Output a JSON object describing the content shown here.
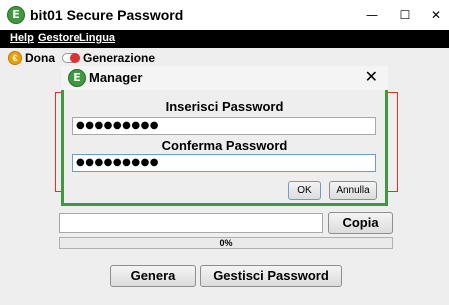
{
  "window": {
    "title": "bit01 Secure Password",
    "minimize_glyph": "—",
    "maximize_glyph": "☐",
    "close_glyph": "✕"
  },
  "menu": {
    "items": [
      "Help",
      "Gestore",
      "Lingua"
    ]
  },
  "toolbar": {
    "dona_label": "Dona",
    "generazione_label": "Generazione",
    "dona_icon": "coin-icon",
    "generazione_icon": "toggle-icon"
  },
  "main": {
    "copy_label": "Copia",
    "progress_text": "0%",
    "progress_value": 0,
    "genera_label": "Genera",
    "gestisci_label": "Gestisci Password"
  },
  "dialog": {
    "title": "Manager",
    "close_glyph": "✕",
    "password_label": "Inserisci Password",
    "password_value": "●●●●●●●●●",
    "confirm_label": "Conferma Password",
    "confirm_value": "●●●●●●●●●",
    "ok_label": "OK",
    "cancel_label": "Annulla"
  },
  "colors": {
    "dialog_border": "#3e9a3e",
    "frame_red": "#e03030",
    "menubar": "#000000"
  }
}
